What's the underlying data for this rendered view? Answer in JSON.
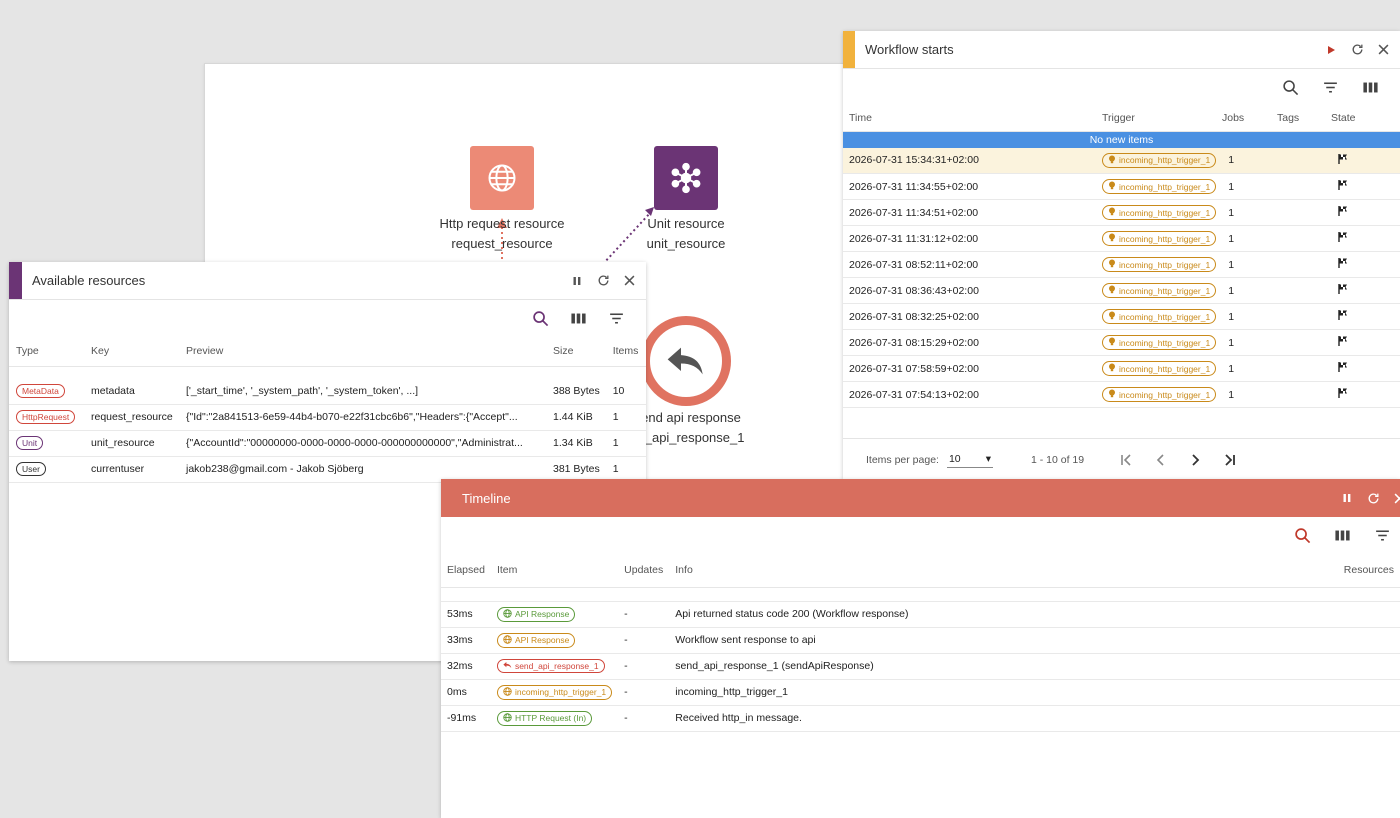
{
  "canvas": {
    "nodes": {
      "http": {
        "line1": "Http request resource",
        "line2": "request_resource"
      },
      "unit": {
        "line1": "Unit resource",
        "line2": "unit_resource"
      },
      "send": {
        "line1": "end api response",
        "line2": "d_api_response_1"
      }
    }
  },
  "resources": {
    "title": "Available resources",
    "columns": [
      "Type",
      "Key",
      "Preview",
      "Size",
      "Items"
    ],
    "rows": [
      {
        "type": "MetaData",
        "color": "#d0463b",
        "key": "metadata",
        "preview": "['_start_time', '_system_path', '_system_token', ...]",
        "size": "388 Bytes",
        "items": "10"
      },
      {
        "type": "HttpRequest",
        "color": "#d0463b",
        "key": "request_resource",
        "preview": "{\"Id\":\"2a841513-6e59-44b4-b070-e22f31cbc6b6\",\"Headers\":{\"Accept\"...",
        "size": "1.44 KiB",
        "items": "1"
      },
      {
        "type": "Unit",
        "color": "#6b3475",
        "key": "unit_resource",
        "preview": "{\"AccountId\":\"00000000-0000-0000-0000-000000000000\",\"Administrat...",
        "size": "1.34 KiB",
        "items": "1"
      },
      {
        "type": "User",
        "color": "#333333",
        "key": "currentuser",
        "preview": "jakob238@gmail.com - Jakob Sjöberg",
        "size": "381 Bytes",
        "items": "1"
      }
    ]
  },
  "workflow": {
    "title": "Workflow starts",
    "columns": [
      "Time",
      "Trigger",
      "Jobs",
      "Tags",
      "State"
    ],
    "banner": "No new items",
    "rows": [
      {
        "time": "2026-07-31 15:34:31+02:00",
        "trigger": "incoming_http_trigger_1",
        "jobs": "1"
      },
      {
        "time": "2026-07-31 11:34:55+02:00",
        "trigger": "incoming_http_trigger_1",
        "jobs": "1"
      },
      {
        "time": "2026-07-31 11:34:51+02:00",
        "trigger": "incoming_http_trigger_1",
        "jobs": "1"
      },
      {
        "time": "2026-07-31 11:31:12+02:00",
        "trigger": "incoming_http_trigger_1",
        "jobs": "1"
      },
      {
        "time": "2026-07-31 08:52:11+02:00",
        "trigger": "incoming_http_trigger_1",
        "jobs": "1"
      },
      {
        "time": "2026-07-31 08:36:43+02:00",
        "trigger": "incoming_http_trigger_1",
        "jobs": "1"
      },
      {
        "time": "2026-07-31 08:32:25+02:00",
        "trigger": "incoming_http_trigger_1",
        "jobs": "1"
      },
      {
        "time": "2026-07-31 08:15:29+02:00",
        "trigger": "incoming_http_trigger_1",
        "jobs": "1"
      },
      {
        "time": "2026-07-31 07:58:59+02:00",
        "trigger": "incoming_http_trigger_1",
        "jobs": "1"
      },
      {
        "time": "2026-07-31 07:54:13+02:00",
        "trigger": "incoming_http_trigger_1",
        "jobs": "1"
      }
    ],
    "pager": {
      "items_per_page_label": "Items per page:",
      "items_per_page": "10",
      "range": "1 - 10 of 19"
    }
  },
  "timeline": {
    "title": "Timeline",
    "columns": [
      "Elapsed",
      "Item",
      "Updates",
      "Info",
      "Resources"
    ],
    "rows": [
      {
        "elapsed": "53ms",
        "item": "API Response",
        "color": "#5a9a3a",
        "icon": "globe-icon",
        "updates": "-",
        "info": "Api returned status code 200 (Workflow response)"
      },
      {
        "elapsed": "33ms",
        "item": "API Response",
        "color": "#c98a1a",
        "icon": "globe-icon",
        "updates": "-",
        "info": "Workflow sent response to api"
      },
      {
        "elapsed": "32ms",
        "item": "send_api_response_1",
        "color": "#d0463b",
        "icon": "reply-icon",
        "updates": "-",
        "info": "send_api_response_1 (sendApiResponse)"
      },
      {
        "elapsed": "0ms",
        "item": "incoming_http_trigger_1",
        "color": "#c98a1a",
        "icon": "globe-icon",
        "updates": "-",
        "info": "incoming_http_trigger_1"
      },
      {
        "elapsed": "-91ms",
        "item": "HTTP Request (In)",
        "color": "#5a9a3a",
        "icon": "globe-icon",
        "updates": "-",
        "info": "Received http_in message."
      }
    ]
  },
  "colors": {
    "resources_accent": "#6b3475",
    "workflow_accent": "#f1b23d",
    "timeline_header": "#d86e5e",
    "banner": "#4a90e2",
    "trigger_badge": "#c98a1a"
  }
}
